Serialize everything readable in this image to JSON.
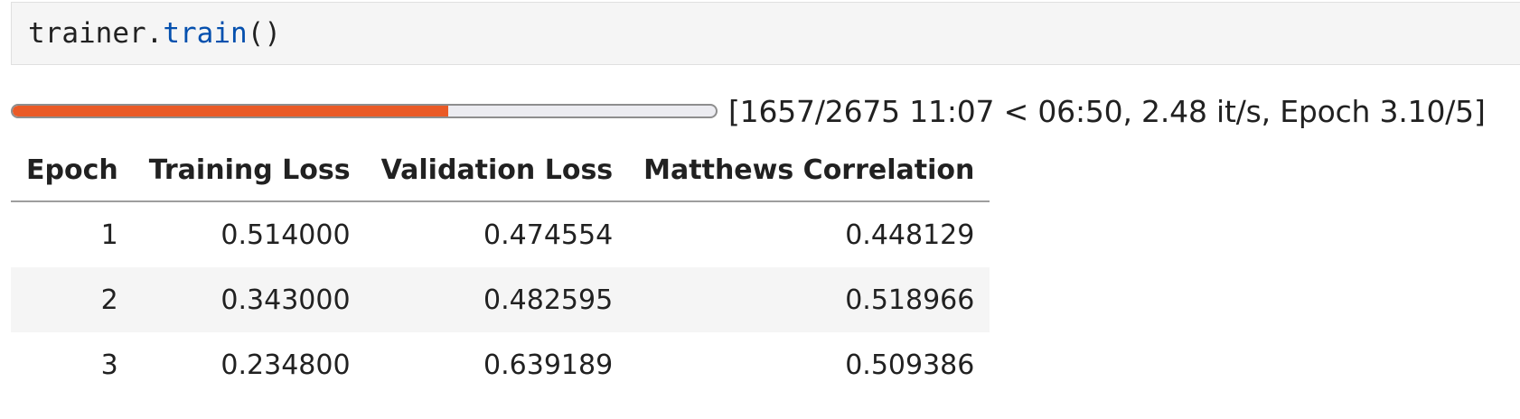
{
  "code_cell": {
    "object": "trainer",
    "dot": ".",
    "method": "train",
    "parens": "()"
  },
  "progress": {
    "fraction": 0.6194,
    "text": "[1657/2675 11:07 < 06:50, 2.48 it/s, Epoch 3.10/5]",
    "fill_color": "#ea5a26"
  },
  "metrics_table": {
    "headers": [
      "Epoch",
      "Training Loss",
      "Validation Loss",
      "Matthews Correlation"
    ],
    "rows": [
      [
        "1",
        "0.514000",
        "0.474554",
        "0.448129"
      ],
      [
        "2",
        "0.343000",
        "0.482595",
        "0.518966"
      ],
      [
        "3",
        "0.234800",
        "0.639189",
        "0.509386"
      ]
    ]
  }
}
